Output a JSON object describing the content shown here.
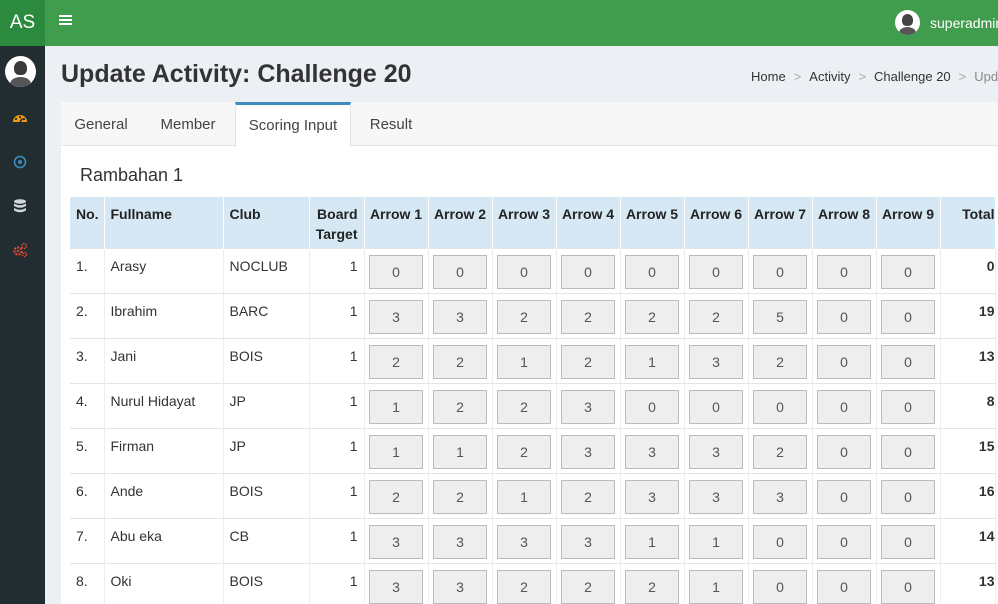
{
  "app": {
    "logo": "AS",
    "user_name": "superadmin"
  },
  "sidebar": {
    "icons": [
      "dashboard-icon",
      "target-icon",
      "database-icon",
      "cogs-icon"
    ]
  },
  "page": {
    "title": "Update Activity: Challenge 20"
  },
  "breadcrumb": {
    "home": "Home",
    "activity": "Activity",
    "challenge": "Challenge 20",
    "current": "Update"
  },
  "tabs": [
    {
      "label": "General"
    },
    {
      "label": "Member"
    },
    {
      "label": "Scoring Input"
    },
    {
      "label": "Result"
    }
  ],
  "section": {
    "title": "Rambahan 1"
  },
  "table": {
    "headers": {
      "no": "No.",
      "fullname": "Fullname",
      "club": "Club",
      "board_line1": "Board",
      "board_line2": "Target",
      "arrows": [
        "Arrow 1",
        "Arrow 2",
        "Arrow 3",
        "Arrow 4",
        "Arrow 5",
        "Arrow 6",
        "Arrow 7",
        "Arrow 8",
        "Arrow 9"
      ],
      "total": "Total"
    },
    "rows": [
      {
        "no": "1.",
        "name": "Arasy",
        "club": "NOCLUB",
        "board": "1",
        "scores": [
          "0",
          "0",
          "0",
          "0",
          "0",
          "0",
          "0",
          "0",
          "0"
        ],
        "total": "0"
      },
      {
        "no": "2.",
        "name": "Ibrahim",
        "club": "BARC",
        "board": "1",
        "scores": [
          "3",
          "3",
          "2",
          "2",
          "2",
          "2",
          "5",
          "0",
          "0"
        ],
        "total": "19"
      },
      {
        "no": "3.",
        "name": "Jani",
        "club": "BOIS",
        "board": "1",
        "scores": [
          "2",
          "2",
          "1",
          "2",
          "1",
          "3",
          "2",
          "0",
          "0"
        ],
        "total": "13"
      },
      {
        "no": "4.",
        "name": "Nurul Hidayat",
        "club": "JP",
        "board": "1",
        "scores": [
          "1",
          "2",
          "2",
          "3",
          "0",
          "0",
          "0",
          "0",
          "0"
        ],
        "total": "8"
      },
      {
        "no": "5.",
        "name": "Firman",
        "club": "JP",
        "board": "1",
        "scores": [
          "1",
          "1",
          "2",
          "3",
          "3",
          "3",
          "2",
          "0",
          "0"
        ],
        "total": "15"
      },
      {
        "no": "6.",
        "name": "Ande",
        "club": "BOIS",
        "board": "1",
        "scores": [
          "2",
          "2",
          "1",
          "2",
          "3",
          "3",
          "3",
          "0",
          "0"
        ],
        "total": "16"
      },
      {
        "no": "7.",
        "name": "Abu eka",
        "club": "CB",
        "board": "1",
        "scores": [
          "3",
          "3",
          "3",
          "3",
          "1",
          "1",
          "0",
          "0",
          "0"
        ],
        "total": "14"
      },
      {
        "no": "8.",
        "name": "Oki",
        "club": "BOIS",
        "board": "1",
        "scores": [
          "3",
          "3",
          "2",
          "2",
          "2",
          "1",
          "0",
          "0",
          "0"
        ],
        "total": "13"
      }
    ]
  }
}
